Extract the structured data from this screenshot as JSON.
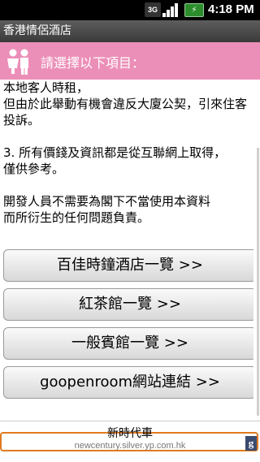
{
  "status_bar": {
    "network": "3G",
    "time": "4:18 PM"
  },
  "app": {
    "title": "香港情侶酒店"
  },
  "header": {
    "icon": "couple-icon",
    "text": "請選擇以下項目："
  },
  "content": {
    "paragraphs": [
      "本地客人時租，\n但由於此舉動有機會違反大廈公契，引來住客投訴。",
      "3. 所有價錢及資訊都是從互聯網上取得，\n僅供參考。",
      "開發人員不需要為閣下不當使用本資料\n而所衍生的任何問題負責。"
    ]
  },
  "buttons": [
    {
      "label": "百佳時鐘酒店一覽 >>"
    },
    {
      "label": "紅茶館一覽 >>"
    },
    {
      "label": "一般賓館一覽 >>"
    },
    {
      "label": "goopenroom網站連結 >>"
    }
  ],
  "ad": {
    "title": "新時代車",
    "url": "newcentury.silver.yp.com.hk",
    "badge": "g"
  },
  "colors": {
    "header_pink": "#ec8fb8",
    "ad_border": "#e07a20"
  }
}
